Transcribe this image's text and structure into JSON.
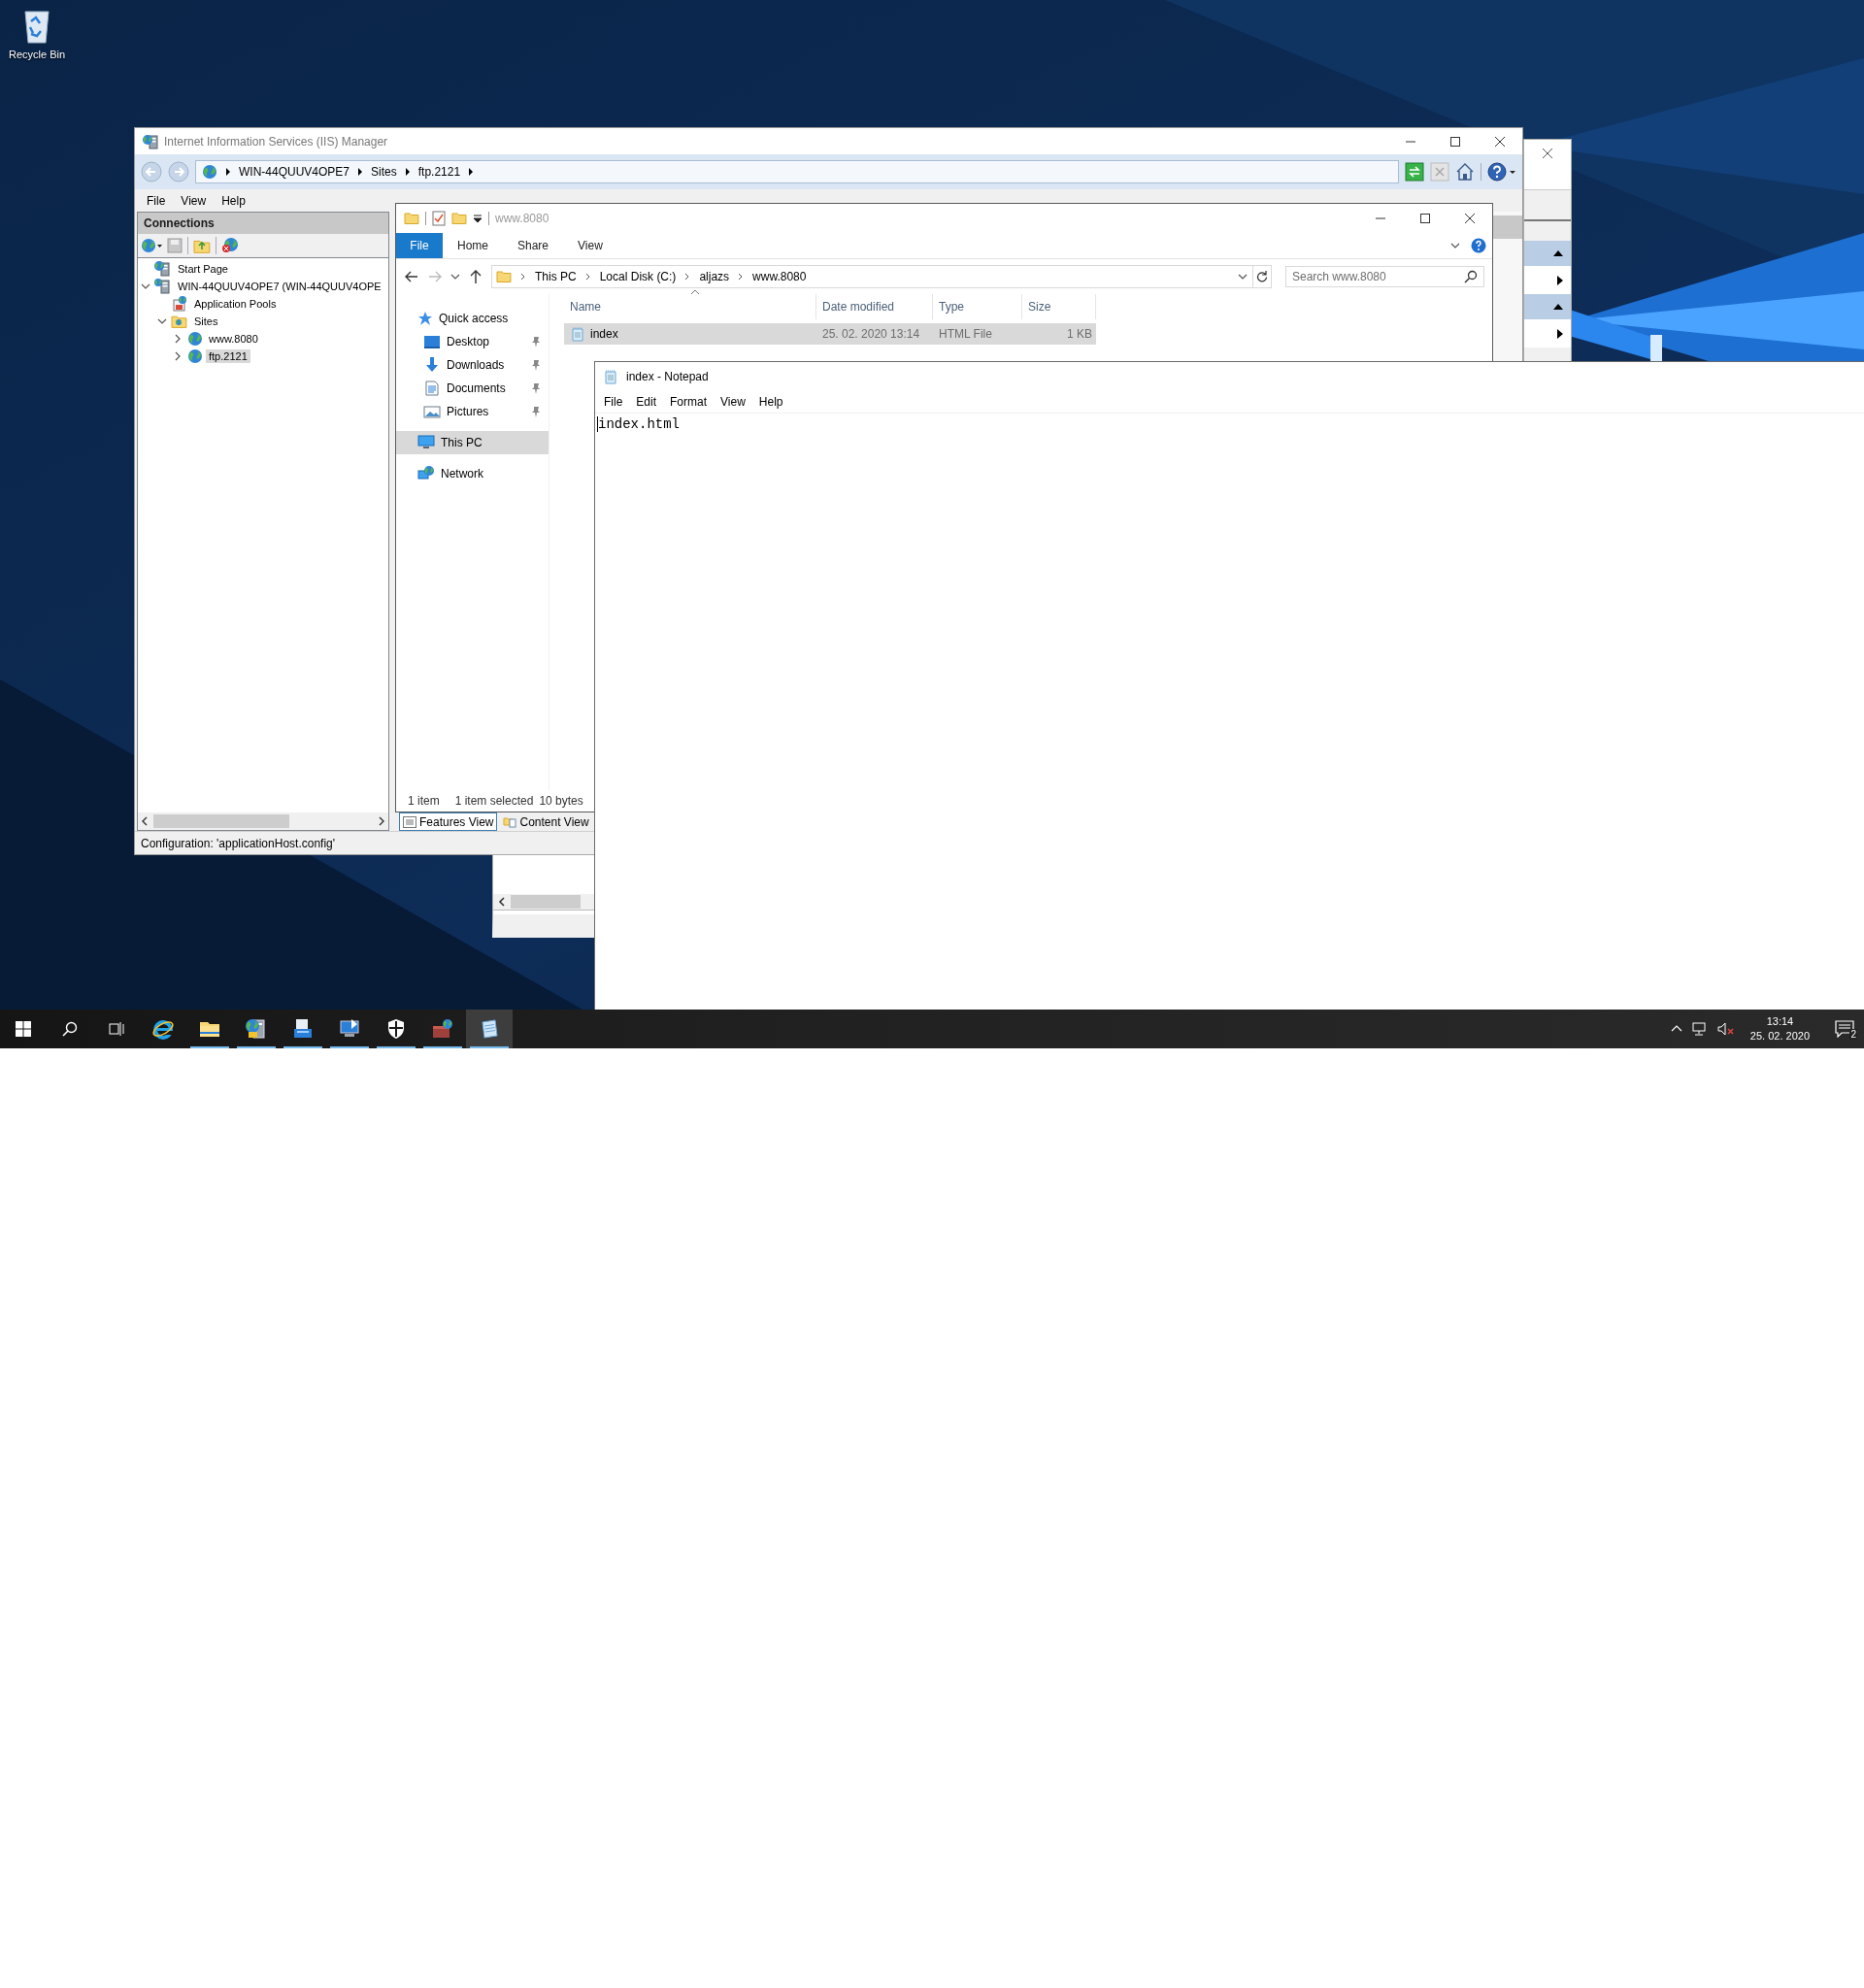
{
  "desktop_icons": [
    {
      "label": "Recycle Bin",
      "kind": "recycle-bin"
    }
  ],
  "iis": {
    "title": "Internet Information Services (IIS) Manager",
    "breadcrumb": [
      "WIN-44QUUV4OPE7",
      "Sites",
      "ftp.2121"
    ],
    "menu": [
      "File",
      "View",
      "Help"
    ],
    "connections": {
      "title": "Connections",
      "tree": [
        {
          "label": "Start Page",
          "kind": "start-page",
          "selected": false
        },
        {
          "label": "WIN-44QUUV4OPE7 (WIN-44QUUV4OPE",
          "kind": "server",
          "expanded": true,
          "selected": false,
          "children": [
            {
              "label": "Application Pools",
              "kind": "app-pools",
              "selected": false
            },
            {
              "label": "Sites",
              "kind": "sites",
              "expanded": true,
              "selected": false,
              "children": [
                {
                  "label": "www.8080",
                  "kind": "site",
                  "expanded": false,
                  "selected": false
                },
                {
                  "label": "ftp.2121",
                  "kind": "site",
                  "expanded": false,
                  "selected": true
                }
              ]
            }
          ]
        }
      ]
    },
    "view_tabs": [
      {
        "label": "Features View",
        "selected": true
      },
      {
        "label": "Content View",
        "selected": false
      }
    ],
    "status": "Configuration: 'applicationHost.config'"
  },
  "explorer": {
    "title": "www.8080",
    "ribbon_tabs": [
      {
        "label": "File",
        "kind": "file-menu"
      },
      {
        "label": "Home",
        "kind": "tab"
      },
      {
        "label": "Share",
        "kind": "tab"
      },
      {
        "label": "View",
        "kind": "tab"
      }
    ],
    "path": [
      "This PC",
      "Local Disk (C:)",
      "aljazs",
      "www.8080"
    ],
    "search": {
      "placeholder": "Search www.8080"
    },
    "nav": [
      {
        "label": "Quick access",
        "kind": "star",
        "selected": false,
        "children": [
          {
            "label": "Desktop",
            "kind": "desktop",
            "pinned": true,
            "selected": false
          },
          {
            "label": "Downloads",
            "kind": "downloads",
            "pinned": true,
            "selected": false
          },
          {
            "label": "Documents",
            "kind": "documents",
            "pinned": true,
            "selected": false
          },
          {
            "label": "Pictures",
            "kind": "pictures",
            "pinned": true,
            "selected": false
          }
        ]
      },
      {
        "label": "This PC",
        "kind": "pc",
        "selected": true
      },
      {
        "label": "Network",
        "kind": "network",
        "selected": false
      }
    ],
    "columns": [
      "Name",
      "Date modified",
      "Type",
      "Size"
    ],
    "files": [
      {
        "name": "index",
        "date": "25. 02. 2020 13:14",
        "type": "HTML File",
        "size": "1 KB",
        "selected": true
      }
    ],
    "status": {
      "count": "1 item",
      "selection": "1 item selected",
      "size": "10 bytes"
    }
  },
  "notepad": {
    "title": "index - Notepad",
    "menu": [
      "File",
      "Edit",
      "Format",
      "View",
      "Help"
    ],
    "text": "index.html"
  },
  "taskbar": {
    "apps": [
      {
        "kind": "browser",
        "running": false,
        "selected": false
      },
      {
        "kind": "folder",
        "running": true,
        "selected": false
      },
      {
        "kind": "iis",
        "running": true,
        "selected": false
      },
      {
        "kind": "server",
        "running": true,
        "selected": false
      },
      {
        "kind": "computer",
        "running": true,
        "selected": false
      },
      {
        "kind": "shield",
        "running": true,
        "selected": false
      },
      {
        "kind": "briefcase",
        "running": true,
        "selected": false
      },
      {
        "kind": "notepad",
        "running": true,
        "selected": true
      }
    ],
    "clock": {
      "time": "13:14",
      "date": "25. 02. 2020"
    },
    "notifications": "2"
  }
}
